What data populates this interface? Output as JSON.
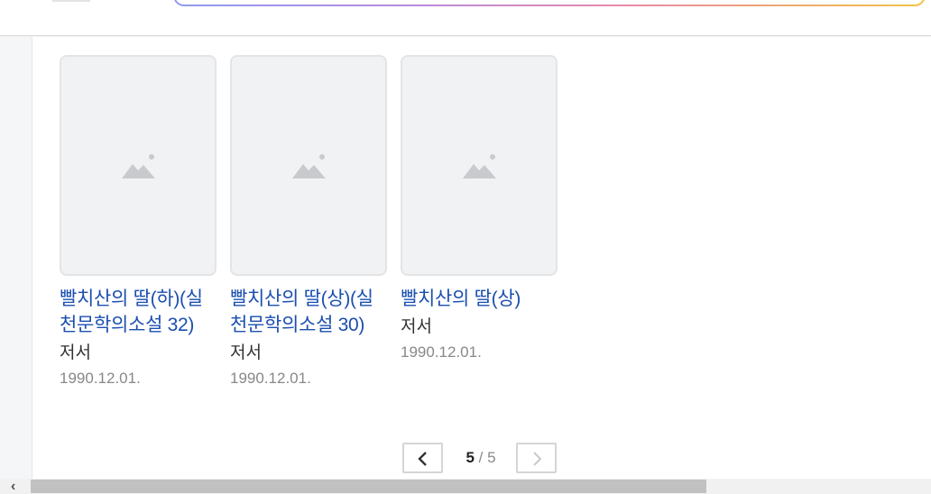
{
  "header": {
    "menu_icon": "menu-icon",
    "search_placeholder": ""
  },
  "books": [
    {
      "title": "빨치산의 딸(하)(실천문학의소설 32)",
      "role": "저서",
      "date": "1990.12.01.",
      "image_icon": "image-placeholder-icon"
    },
    {
      "title": "빨치산의 딸(상)(실천문학의소설 30)",
      "role": "저서",
      "date": "1990.12.01.",
      "image_icon": "image-placeholder-icon"
    },
    {
      "title": "빨치산의 딸(상)",
      "role": "저서",
      "date": "1990.12.01.",
      "image_icon": "image-placeholder-icon"
    }
  ],
  "pagination": {
    "current": "5",
    "separator": " / ",
    "total": "5",
    "prev_icon": "chevron-left-icon",
    "next_icon": "chevron-right-icon"
  },
  "scrollbar": {
    "left_arrow": "‹",
    "position": 0.73
  },
  "colors": {
    "link": "#1b4fb0",
    "muted": "#888888",
    "thumb_bg": "#f1f2f4"
  }
}
